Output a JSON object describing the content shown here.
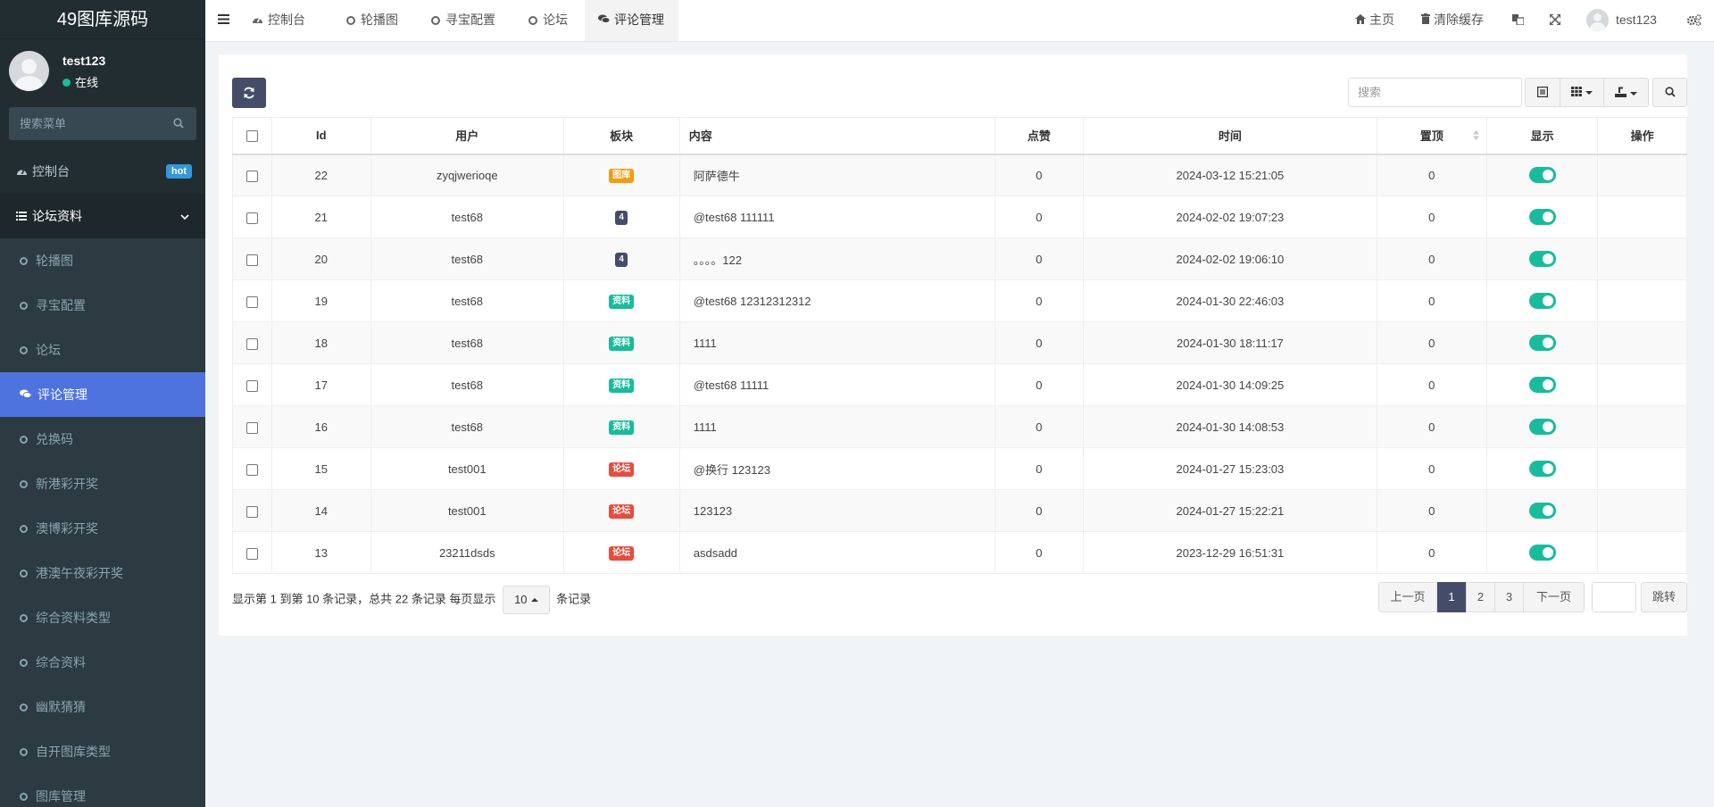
{
  "app": {
    "title": "49图库源码"
  },
  "user": {
    "name": "test123",
    "status": "在线"
  },
  "sidebar": {
    "search_placeholder": "搜索菜单",
    "dashboard": {
      "label": "控制台",
      "badge": "hot"
    },
    "group": {
      "label": "论坛资料"
    },
    "items": [
      {
        "label": "轮播图"
      },
      {
        "label": "寻宝配置"
      },
      {
        "label": "论坛"
      },
      {
        "label": "评论管理",
        "active": true
      },
      {
        "label": "兑换码"
      },
      {
        "label": "新港彩开奖"
      },
      {
        "label": "澳博彩开奖"
      },
      {
        "label": "港澳午夜彩开奖"
      },
      {
        "label": "综合资料类型"
      },
      {
        "label": "综合资料"
      },
      {
        "label": "幽默猜猜"
      },
      {
        "label": "自开图库类型"
      },
      {
        "label": "图库管理"
      }
    ]
  },
  "navbar": {
    "tabs": [
      {
        "label": "控制台"
      },
      {
        "label": "轮播图"
      },
      {
        "label": "寻宝配置"
      },
      {
        "label": "论坛"
      },
      {
        "label": "评论管理"
      }
    ],
    "home": "主页",
    "clear_cache": "清除缓存",
    "user": "test123"
  },
  "toolbar": {
    "search_placeholder": "搜索"
  },
  "table": {
    "headers": {
      "id": "Id",
      "user": "用户",
      "section": "板块",
      "content": "内容",
      "likes": "点赞",
      "time": "时间",
      "pinned": "置顶",
      "show": "显示",
      "action": "操作"
    },
    "rows": [
      {
        "id": "22",
        "user": "zyqjwerioqe",
        "tag": "图库",
        "tag_color": "#f39c12",
        "content": "阿萨德牛",
        "likes": "0",
        "time": "2024-03-12 15:21:05",
        "pinned": "0"
      },
      {
        "id": "21",
        "user": "test68",
        "tag": "4",
        "tag_color": "#444c69",
        "content": "@test68 111111",
        "likes": "0",
        "time": "2024-02-02 19:07:23",
        "pinned": "0"
      },
      {
        "id": "20",
        "user": "test68",
        "tag": "4",
        "tag_color": "#444c69",
        "content": "。。。。122",
        "likes": "0",
        "time": "2024-02-02 19:06:10",
        "pinned": "0"
      },
      {
        "id": "19",
        "user": "test68",
        "tag": "资料",
        "tag_color": "#18bc9c",
        "content": "@test68 12312312312",
        "likes": "0",
        "time": "2024-01-30 22:46:03",
        "pinned": "0"
      },
      {
        "id": "18",
        "user": "test68",
        "tag": "资料",
        "tag_color": "#18bc9c",
        "content": "1111",
        "likes": "0",
        "time": "2024-01-30 18:11:17",
        "pinned": "0"
      },
      {
        "id": "17",
        "user": "test68",
        "tag": "资料",
        "tag_color": "#18bc9c",
        "content": "@test68 11111",
        "likes": "0",
        "time": "2024-01-30 14:09:25",
        "pinned": "0"
      },
      {
        "id": "16",
        "user": "test68",
        "tag": "资料",
        "tag_color": "#18bc9c",
        "content": "1111",
        "likes": "0",
        "time": "2024-01-30 14:08:53",
        "pinned": "0"
      },
      {
        "id": "15",
        "user": "test001",
        "tag": "论坛",
        "tag_color": "#e74c3c",
        "content": "@换行 123123",
        "likes": "0",
        "time": "2024-01-27 15:23:03",
        "pinned": "0"
      },
      {
        "id": "14",
        "user": "test001",
        "tag": "论坛",
        "tag_color": "#e74c3c",
        "content": "123123",
        "likes": "0",
        "time": "2024-01-27 15:22:21",
        "pinned": "0"
      },
      {
        "id": "13",
        "user": "23211dsds",
        "tag": "论坛",
        "tag_color": "#e74c3c",
        "content": "asdsadd",
        "likes": "0",
        "time": "2023-12-29 16:51:31",
        "pinned": "0"
      }
    ]
  },
  "pagination": {
    "info_prefix": "显示第 1 到第 10 条记录，总共 22 条记录 每页显示",
    "page_size": "10",
    "info_suffix": "条记录",
    "prev": "上一页",
    "pages": [
      "1",
      "2",
      "3"
    ],
    "next": "下一页",
    "jump": "跳转"
  },
  "colors": {
    "sidebar_bg": "#222d32",
    "active": "#4e73df",
    "primary": "#444c69",
    "success": "#18bc9c",
    "warning": "#f39c12",
    "danger": "#e74c3c",
    "info": "#3498db"
  }
}
